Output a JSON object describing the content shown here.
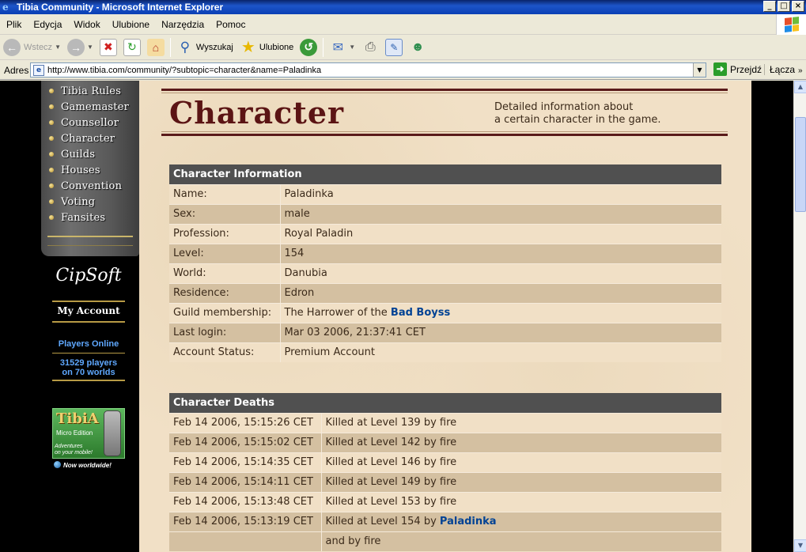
{
  "window": {
    "title": "Tibia Community - Microsoft Internet Explorer",
    "app_icon": "e",
    "controls": [
      "_",
      "□",
      "×"
    ]
  },
  "menu": [
    "Plik",
    "Edycja",
    "Widok",
    "Ulubione",
    "Narzędzia",
    "Pomoc"
  ],
  "toolbar": {
    "back_label": "Wstecz",
    "search_label": "Wyszukaj",
    "favorites_label": "Ulubione"
  },
  "address": {
    "label": "Adres",
    "url": "http://www.tibia.com/community/?subtopic=character&name=Paladinka",
    "go_label": "Przejdź",
    "links_label": "Łącza"
  },
  "nav": {
    "items": [
      "Tibia Rules",
      "Gamemaster",
      "Counsellor",
      "Character",
      "Guilds",
      "Houses",
      "Convention",
      "Voting",
      "Fansites"
    ],
    "cipsoft_logo": "CipSoft",
    "my_account": "My Account",
    "players_online_title": "Players Online",
    "players_online_line1": "31529 players",
    "players_online_line2": "on 70 worlds",
    "tibiame": {
      "logo": "TibiA",
      "subtitle": "Micro Edition",
      "tagline_1": "Adventures",
      "tagline_2": "on your mobile!",
      "worldwide": "Now worldwide!"
    }
  },
  "page": {
    "heading": "Character",
    "description_line1": "Detailed information about",
    "description_line2": "a certain character in the game."
  },
  "character_info": {
    "title": "Character Information",
    "rows": [
      {
        "label": "Name:",
        "value": "Paladinka"
      },
      {
        "label": "Sex:",
        "value": "male"
      },
      {
        "label": "Profession:",
        "value": "Royal Paladin"
      },
      {
        "label": "Level:",
        "value": "154"
      },
      {
        "label": "World:",
        "value": "Danubia"
      },
      {
        "label": "Residence:",
        "value": "Edron"
      },
      {
        "label": "Guild membership:",
        "value": "The Harrower of the ",
        "link": "Bad Boyss"
      },
      {
        "label": "Last login:",
        "value": "Mar 03 2006, 21:37:41 CET"
      },
      {
        "label": "Account Status:",
        "value": "Premium Account"
      }
    ]
  },
  "character_deaths": {
    "title": "Character Deaths",
    "rows": [
      {
        "date": "Feb 14 2006, 15:15:26 CET",
        "text": "Killed at Level 139 by fire"
      },
      {
        "date": "Feb 14 2006, 15:15:02 CET",
        "text": "Killed at Level 142 by fire"
      },
      {
        "date": "Feb 14 2006, 15:14:35 CET",
        "text": "Killed at Level 146 by fire"
      },
      {
        "date": "Feb 14 2006, 15:14:11 CET",
        "text": "Killed at Level 149 by fire"
      },
      {
        "date": "Feb 14 2006, 15:13:48 CET",
        "text": "Killed at Level 153 by fire"
      },
      {
        "date": "Feb 14 2006, 15:13:19 CET",
        "text": "Killed at Level 154 by ",
        "link": "Paladinka"
      },
      {
        "date": "",
        "text": "and by fire"
      }
    ]
  },
  "colors": {
    "header_bg": "#505050",
    "row_light": "#f1e0c6",
    "row_dark": "#d4c0a1",
    "link": "#004294",
    "heading": "#5b1414"
  }
}
